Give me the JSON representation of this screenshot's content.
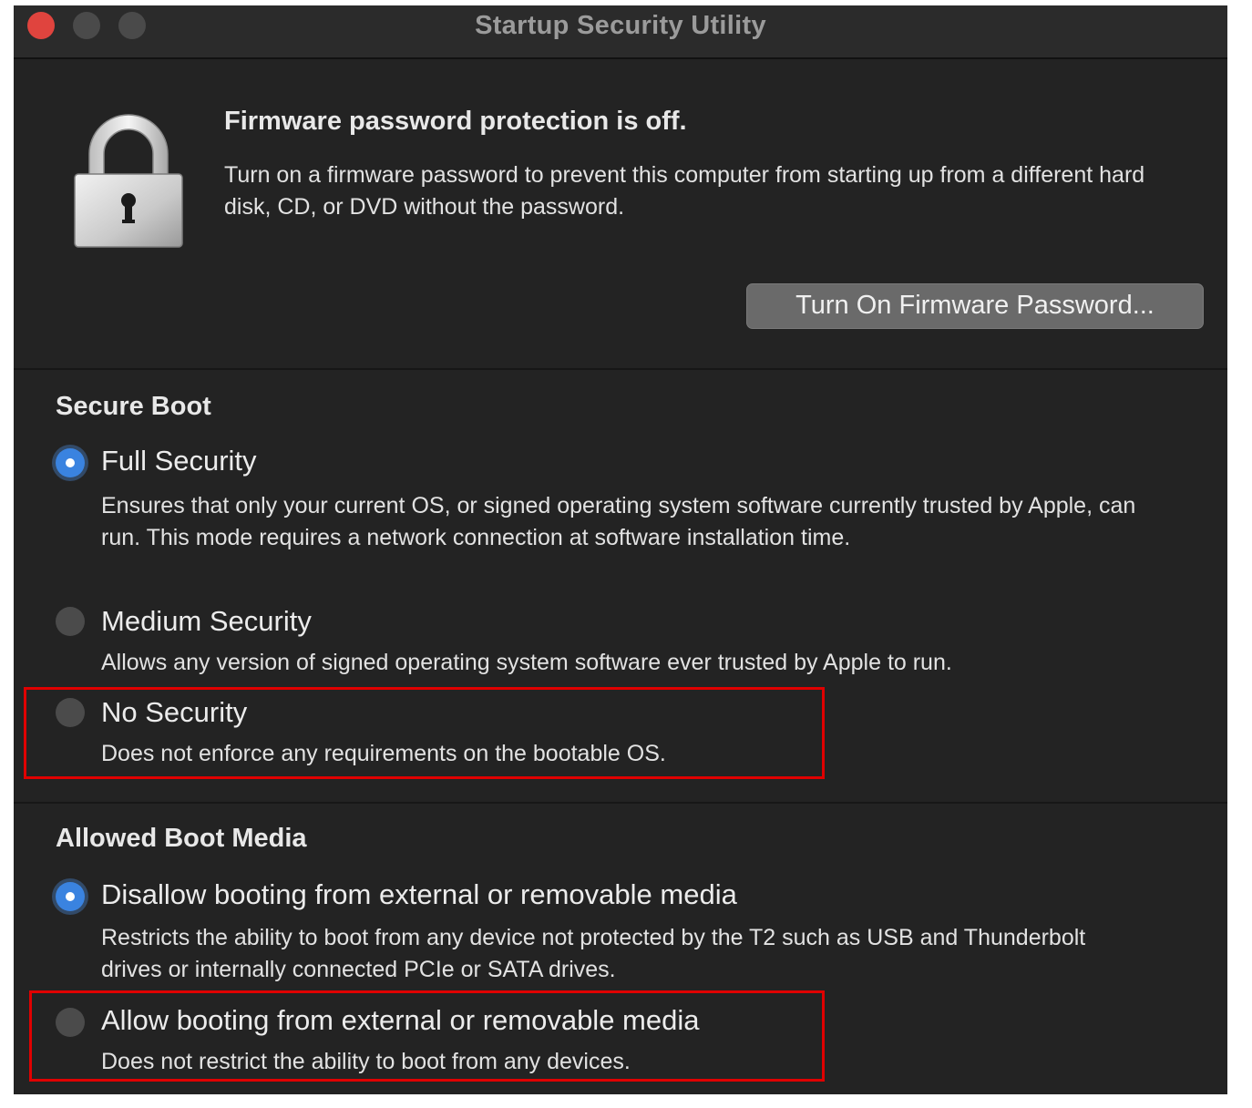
{
  "window": {
    "title": "Startup Security Utility"
  },
  "firmware": {
    "heading": "Firmware password protection is off.",
    "description": "Turn on a firmware password to prevent this computer from starting up from a different hard disk, CD, or DVD without the password.",
    "button_label": "Turn On Firmware Password..."
  },
  "secure_boot": {
    "title": "Secure Boot",
    "options": [
      {
        "label": "Full Security",
        "description": "Ensures that only your current OS, or signed operating system software currently trusted by Apple, can run. This mode requires a network connection at software installation time.",
        "selected": true
      },
      {
        "label": "Medium Security",
        "description": "Allows any version of signed operating system software ever trusted by Apple to run.",
        "selected": false
      },
      {
        "label": "No Security",
        "description": "Does not enforce any requirements on the bootable OS.",
        "selected": false
      }
    ]
  },
  "boot_media": {
    "title": "Allowed Boot Media",
    "options": [
      {
        "label": "Disallow booting from external or removable media",
        "description": "Restricts the ability to boot from any device not protected by the T2 such as USB and Thunderbolt drives or internally connected PCIe or SATA drives.",
        "selected": true
      },
      {
        "label": "Allow booting from external or removable media",
        "description": "Does not restrict the ability to boot from any devices.",
        "selected": false
      }
    ]
  },
  "colors": {
    "window_bg": "#232323",
    "accent_blue": "#3a83e0",
    "highlight_red": "#e00000",
    "close_red": "#e0443e"
  },
  "icons": {
    "lock": "lock-icon",
    "close": "close-icon"
  }
}
